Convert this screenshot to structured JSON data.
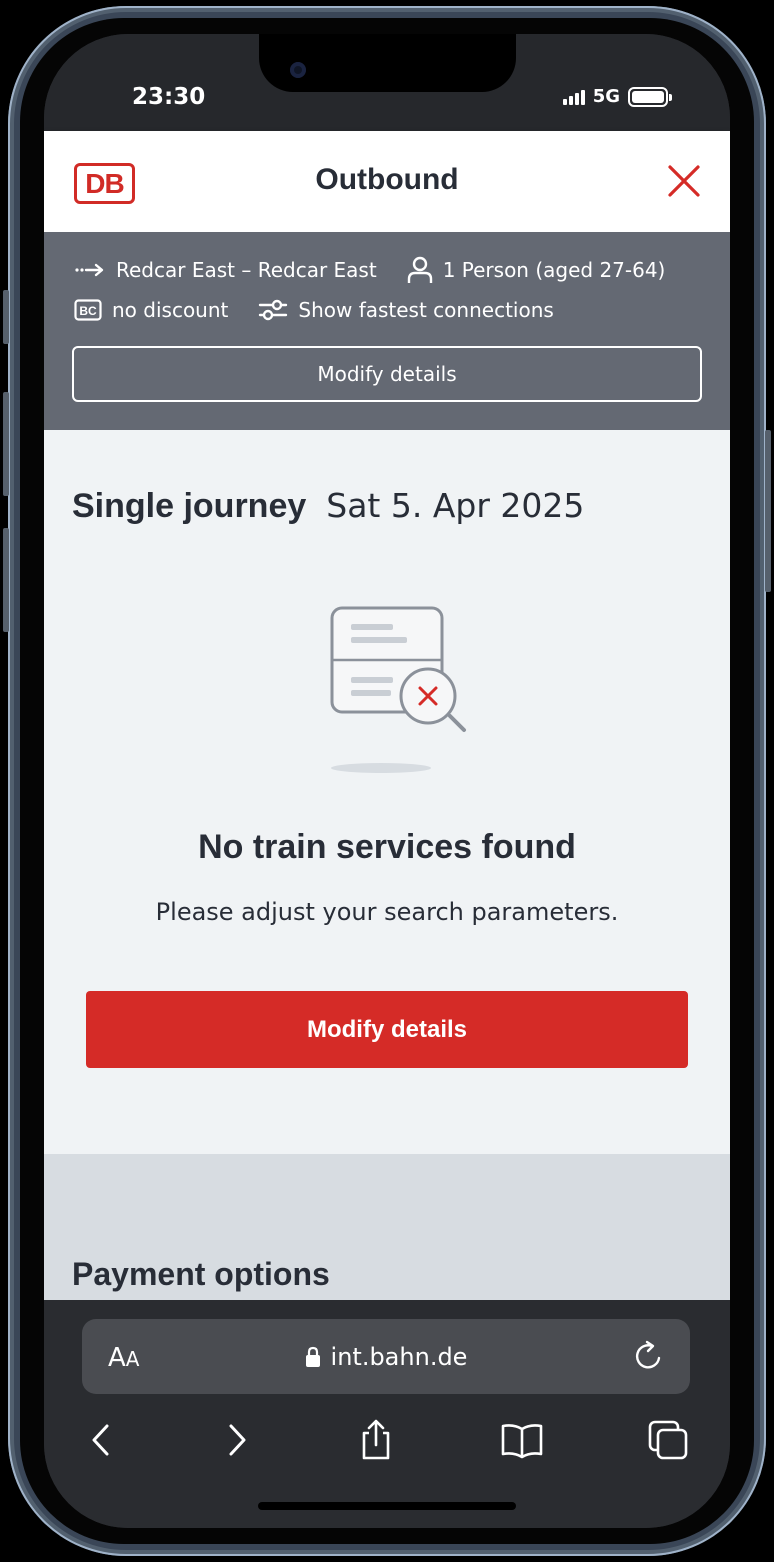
{
  "status_bar": {
    "time": "23:30",
    "network": "5G",
    "icons": [
      "signal-icon",
      "battery-icon"
    ]
  },
  "header": {
    "logo_text": "DB",
    "title": "Outbound",
    "close_icon": "close-icon"
  },
  "summary": {
    "route": "Redcar East – Redcar East",
    "passengers": "1 Person (aged 27-64)",
    "discount": "no discount",
    "connections": "Show fastest connections",
    "modify_label": "Modify details"
  },
  "journey": {
    "type": "Single journey",
    "date": "Sat 5. Apr 2025"
  },
  "empty_state": {
    "title": "No train services found",
    "message": "Please adjust your search parameters.",
    "button_label": "Modify details"
  },
  "payment": {
    "title": "Payment options"
  },
  "browser": {
    "text_size_label": "AA",
    "url": "int.bahn.de"
  },
  "colors": {
    "accent": "#d52b27",
    "summary_bg": "#646973",
    "page_bg": "#f0f3f5",
    "text": "#282d37"
  }
}
